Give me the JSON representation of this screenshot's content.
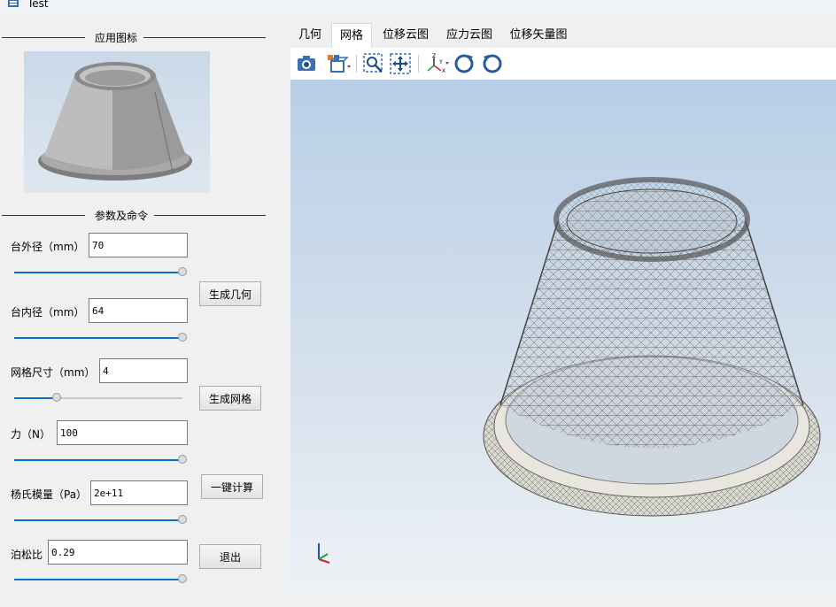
{
  "window": {
    "title": "Test"
  },
  "app_icon_section": {
    "title": "应用图标"
  },
  "params_section": {
    "title": "参数及命令"
  },
  "params": {
    "outer_diameter": {
      "label": "台外径（mm）",
      "value": "70",
      "slider": 1.0
    },
    "inner_diameter": {
      "label": "台内径（mm）",
      "value": "64",
      "slider": 1.0
    },
    "mesh_size": {
      "label": "网格尺寸（mm）",
      "value": "4",
      "slider": 0.25
    },
    "force": {
      "label": "力（N）",
      "value": "100",
      "slider": 1.0
    },
    "youngs_modulus": {
      "label": "杨氏模量（Pa）",
      "value": "2e+11",
      "slider": 1.0
    },
    "poisson_ratio": {
      "label": "泊松比",
      "value": "0.29",
      "slider": 1.0
    }
  },
  "buttons": {
    "generate_geometry": "生成几何",
    "generate_mesh": "生成网格",
    "compute": "一键计算",
    "exit": "退出"
  },
  "tabs": [
    "几何",
    "网格",
    "位移云图",
    "应力云图",
    "位移矢量图"
  ],
  "active_tab": "网格",
  "toolbar_icons": [
    "camera-icon",
    "view-select-icon",
    "zoom-box-icon",
    "fit-all-icon",
    "axes-orientation-icon",
    "rotate-ccw-icon",
    "rotate-cw-icon"
  ],
  "axis_labels": {
    "x": "X",
    "y": "Y",
    "z": "Z"
  },
  "colors": {
    "slider_fill": "#0a6fc8",
    "viewport_top": "#b8cfe7",
    "viewport_bottom": "#eef2f6"
  }
}
